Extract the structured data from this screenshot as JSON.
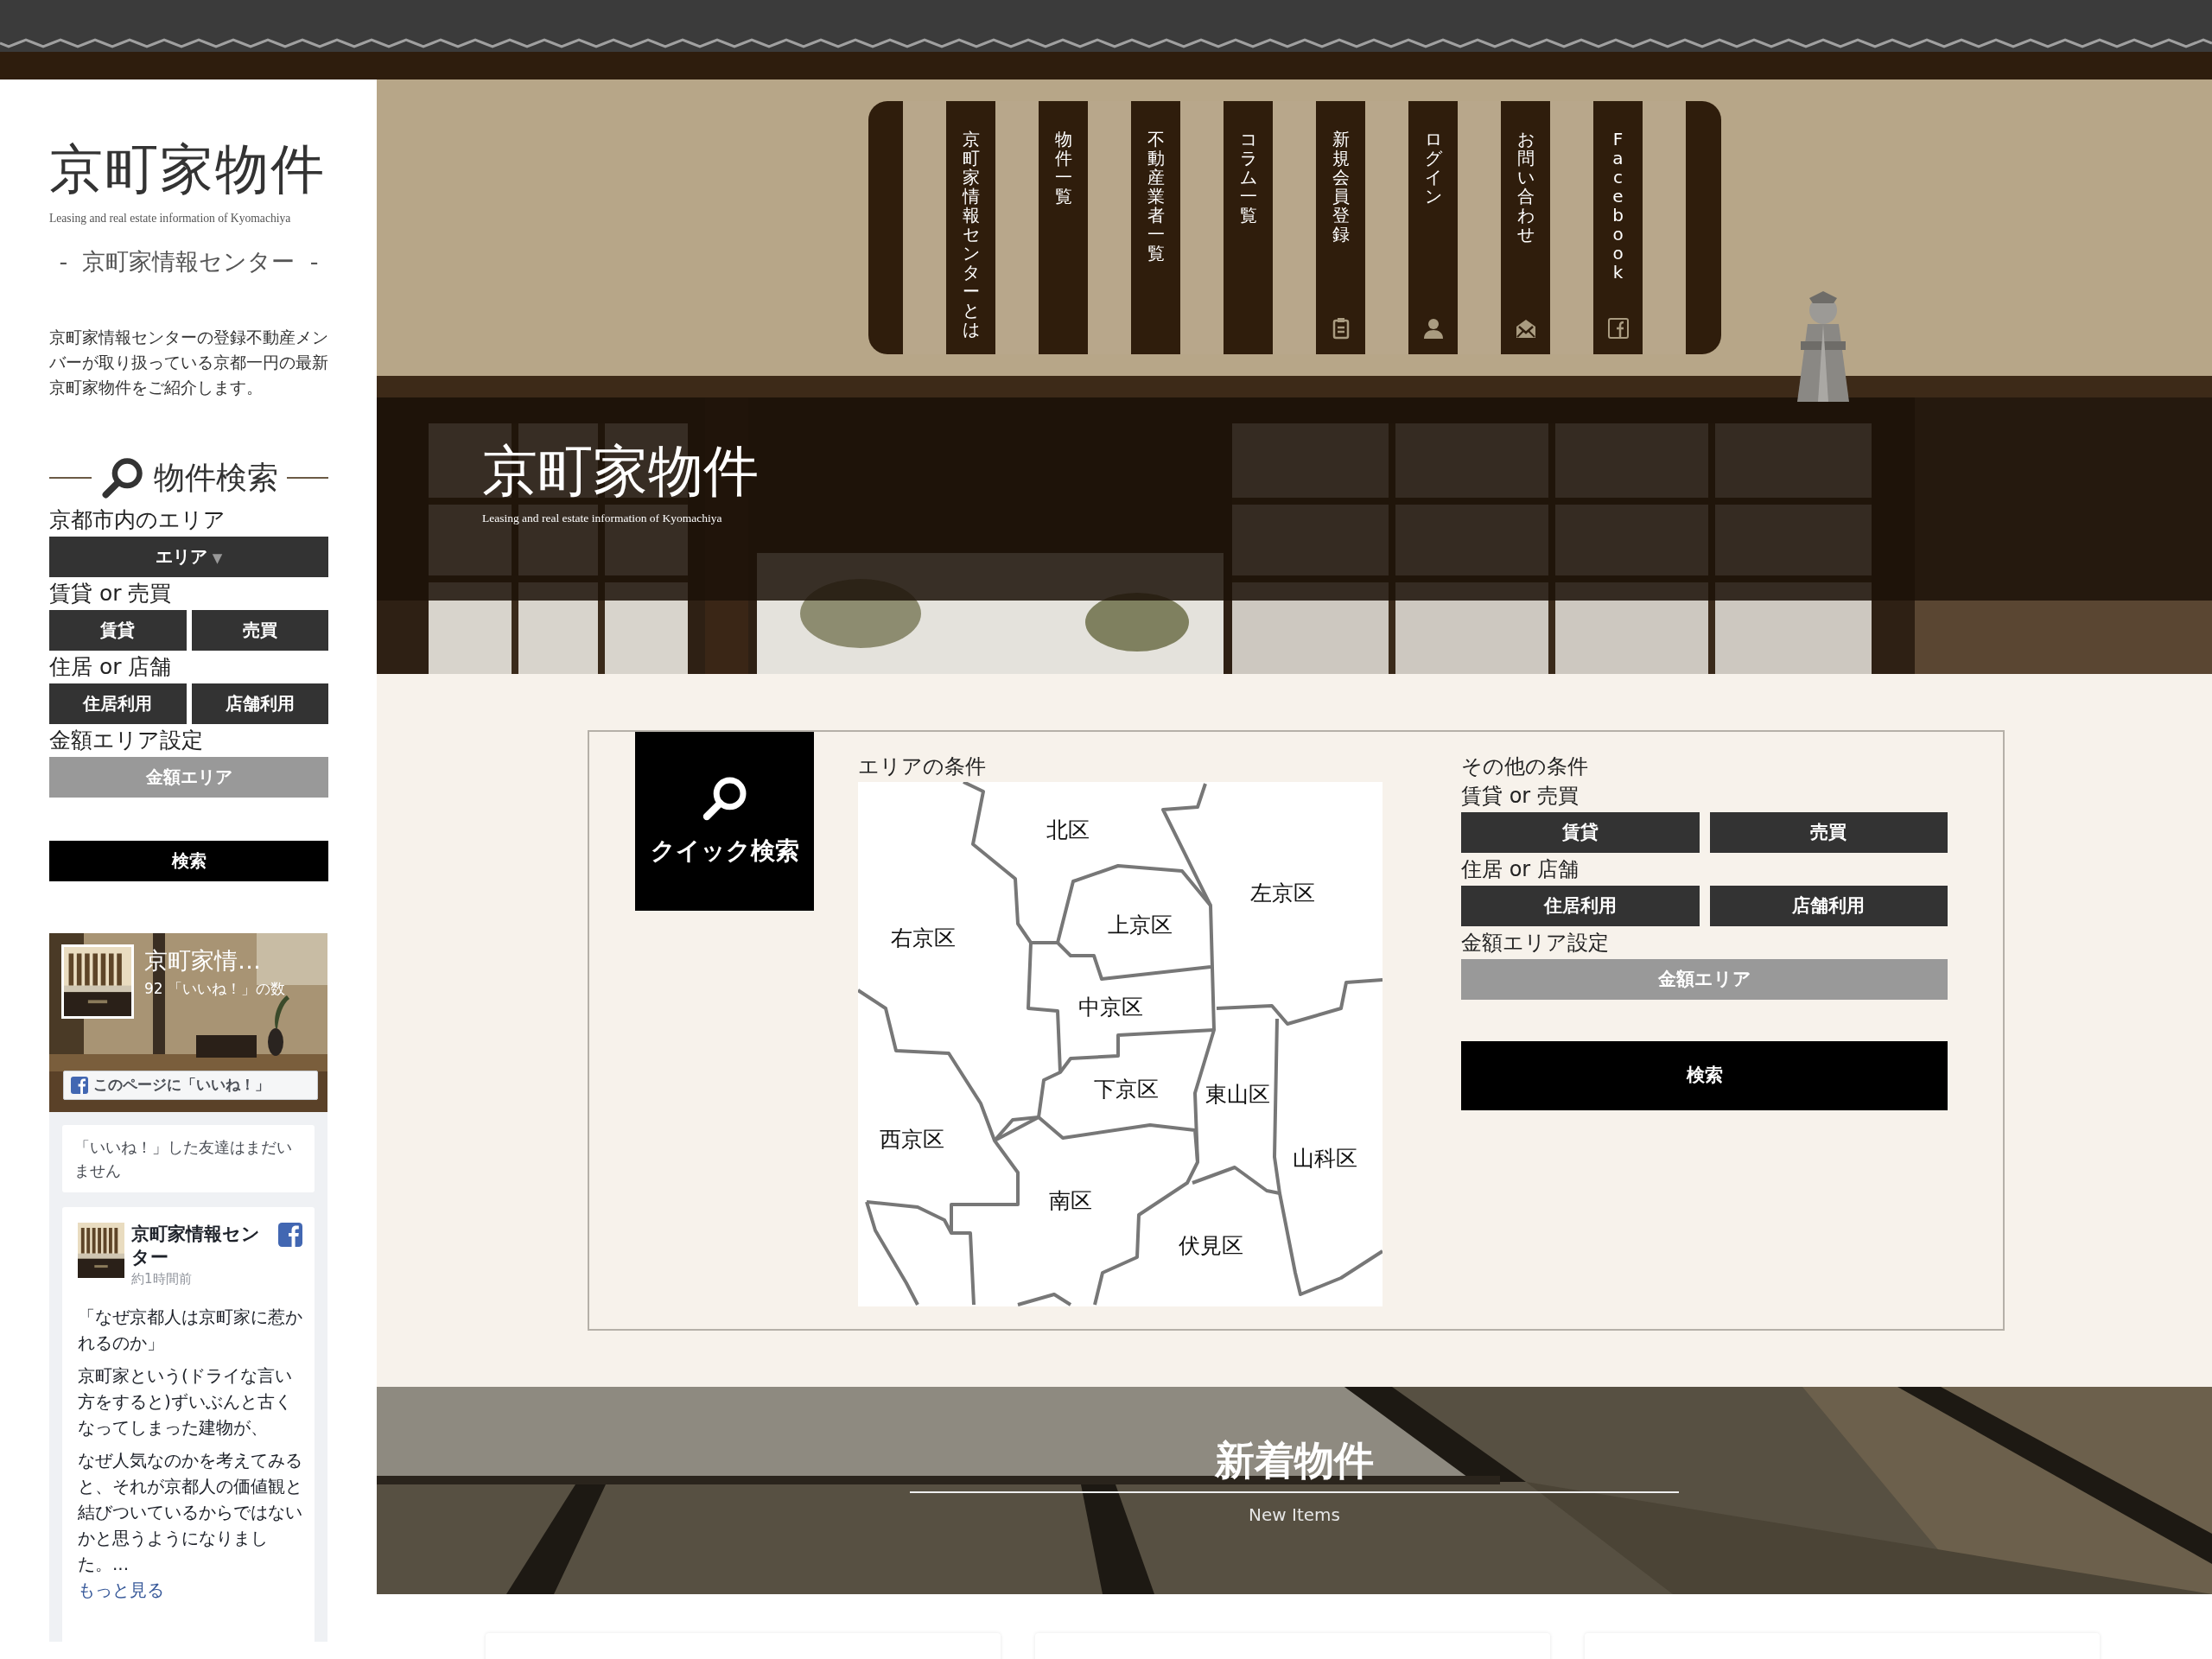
{
  "sidebar": {
    "logo": "京町家物件",
    "logo_subtitle": "Leasing and real estate information of Kyomachiya",
    "tagline": "-  京町家情報センター  -",
    "description": "京町家情報センターの登録不動産メンバーが取り扱っている京都一円の最新京町家物件をご紹介します。",
    "search": {
      "title": "物件検索",
      "groups": [
        {
          "label": "京都市内のエリア",
          "kind": "dropdown",
          "buttons": [
            {
              "text": "エリア",
              "caret": "▼"
            }
          ]
        },
        {
          "label": "賃貸 or 売買",
          "kind": "pair",
          "buttons": [
            {
              "text": "賃貸"
            },
            {
              "text": "売買"
            }
          ]
        },
        {
          "label": "住居 or 店舗",
          "kind": "pair",
          "buttons": [
            {
              "text": "住居利用"
            },
            {
              "text": "店舗利用"
            }
          ]
        },
        {
          "label": "金額エリア設定",
          "kind": "range",
          "buttons": [
            {
              "text": "金額エリア"
            }
          ]
        }
      ],
      "submit": "検索"
    },
    "facebook": {
      "page_name": "京町家情…",
      "likes": "92 「いいね！」の数",
      "like_button": "このページに「いいね！」",
      "friends_note": "「いいね！」した友達はまだいません",
      "post": {
        "author": "京町家情報センター",
        "time": "約1時間前",
        "title": "「なぜ京都人は京町家に惹かれるのか」",
        "body": [
          "京町家という(ドライな言い方をすると)ずいぶんと古くなってしまった建物が、",
          "なぜ人気なのかを考えてみると、それが京都人の価値観と結びついているからではないかと思うようになりました。..."
        ],
        "more": "もっと見る"
      }
    }
  },
  "nav": {
    "tabs": [
      {
        "label": "京町家情報センターとは"
      },
      {
        "label": "物件一覧"
      },
      {
        "label": "不動産業者一覧"
      },
      {
        "label": "コラム一覧"
      },
      {
        "label": "新規会員登録"
      },
      {
        "label": "ログイン"
      },
      {
        "label": "お問い合わせ"
      },
      {
        "label": "Facebook"
      }
    ]
  },
  "hero": {
    "title": "京町家物件",
    "subtitle": "Leasing and real estate information of Kyomachiya"
  },
  "quick_search": {
    "title": "クイック検索",
    "area_label": "エリアの条件",
    "districts": [
      {
        "name": "北区"
      },
      {
        "name": "左京区"
      },
      {
        "name": "上京区"
      },
      {
        "name": "右京区"
      },
      {
        "name": "中京区"
      },
      {
        "name": "下京区"
      },
      {
        "name": "東山区"
      },
      {
        "name": "西京区"
      },
      {
        "name": "山科区"
      },
      {
        "name": "南区"
      },
      {
        "name": "伏見区"
      }
    ],
    "other_label": "その他の条件",
    "groups": [
      {
        "label": "賃貸 or 売買",
        "kind": "pair",
        "buttons": [
          {
            "text": "賃貸"
          },
          {
            "text": "売買"
          }
        ]
      },
      {
        "label": "住居 or 店舗",
        "kind": "pair",
        "buttons": [
          {
            "text": "住居利用"
          },
          {
            "text": "店舗利用"
          }
        ]
      },
      {
        "label": "金額エリア設定",
        "kind": "range",
        "buttons": [
          {
            "text": "金額エリア"
          }
        ]
      }
    ],
    "submit": "検索"
  },
  "new_items": {
    "title": "新着物件",
    "subtitle": "New Items"
  }
}
